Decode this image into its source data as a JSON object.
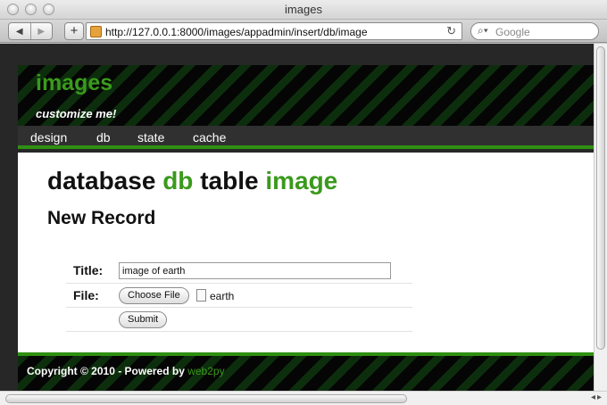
{
  "window": {
    "title": "images"
  },
  "toolbar": {
    "back_label": "◀",
    "forward_label": "▶",
    "add_label": "+",
    "url": "http://127.0.0.1:8000/images/appadmin/insert/db/image",
    "reload_label": "↻",
    "search_placeholder": "Google"
  },
  "site": {
    "title": "images",
    "subtitle": "customize me!",
    "menu": [
      "design",
      "db",
      "state",
      "cache"
    ]
  },
  "main": {
    "heading": {
      "w1": "database",
      "w2": "db",
      "w3": "table",
      "w4": "image"
    },
    "subheading": "New Record",
    "form": {
      "title_label": "Title:",
      "title_value": "image of earth",
      "file_label": "File:",
      "choose_file_label": "Choose File",
      "file_name": "earth",
      "submit_label": "Submit"
    }
  },
  "footer": {
    "text": "Copyright © 2010 - Powered by ",
    "link": "web2py"
  },
  "colors": {
    "accent": "#3a9a1c",
    "header_bg": "#050505",
    "menu_bg": "#303030"
  }
}
